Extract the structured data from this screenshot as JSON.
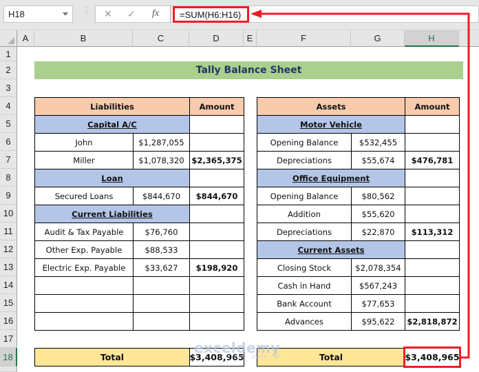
{
  "formula_bar": {
    "name_box": "H18",
    "cancel_icon": "✕",
    "enter_icon": "✓",
    "fx_label": "fx",
    "formula": "=SUM(H6:H16)"
  },
  "columns": [
    "A",
    "B",
    "C",
    "D",
    "E",
    "F",
    "G",
    "H"
  ],
  "selected_column": "H",
  "rows": [
    "1",
    "2",
    "3",
    "4",
    "5",
    "6",
    "7",
    "8",
    "9",
    "10",
    "11",
    "12",
    "13",
    "14",
    "15",
    "16",
    "17",
    "18"
  ],
  "selected_row": "18",
  "title": "Tally Balance Sheet",
  "liabilities": {
    "header": "Liabilities",
    "amount_header": "Amount",
    "sections": {
      "capital": "Capital A/C",
      "loan": "Loan",
      "current": "Current Liabilities"
    },
    "items": [
      {
        "name": "John",
        "value": "$1,287,055",
        "total": ""
      },
      {
        "name": "Miller",
        "value": "$1,078,320",
        "total": "$2,365,375"
      },
      {
        "name": "Secured Loans",
        "value": "$844,670",
        "total": "$844,670"
      },
      {
        "name": "Audit & Tax Payable",
        "value": "$76,760",
        "total": ""
      },
      {
        "name": "Other Exp. Payable",
        "value": "$88,533",
        "total": ""
      },
      {
        "name": "Electric Exp. Payable",
        "value": "$33,627",
        "total": "$198,920"
      }
    ],
    "total_label": "Total",
    "total_value": "$3,408,965"
  },
  "assets": {
    "header": "Assets",
    "amount_header": "Amount",
    "sections": {
      "motor": "Motor Vehicle",
      "office": "Office Equipment",
      "current": "Current Assets"
    },
    "items": [
      {
        "name": "Opening Balance",
        "value": "$532,455",
        "total": ""
      },
      {
        "name": "Depreciations",
        "value": "$55,674",
        "total": "$476,781"
      },
      {
        "name": "Opening Balance",
        "value": "$80,562",
        "total": ""
      },
      {
        "name": "Addition",
        "value": "$55,620",
        "total": ""
      },
      {
        "name": "Depreciations",
        "value": "$22,870",
        "total": "$113,312"
      },
      {
        "name": "Closing Stock",
        "value": "$2,078,354",
        "total": ""
      },
      {
        "name": "Cash in Hand",
        "value": "$567,243",
        "total": ""
      },
      {
        "name": "Bank Account",
        "value": "$77,653",
        "total": ""
      },
      {
        "name": "Advances",
        "value": "$95,622",
        "total": "$2,818,872"
      }
    ],
    "total_label": "Total",
    "total_value": "$3,408,965"
  },
  "watermark": {
    "brand": "exceldemy",
    "tagline": "EXCEL · DATA · BI"
  },
  "annotation_color": "#ee1c24"
}
